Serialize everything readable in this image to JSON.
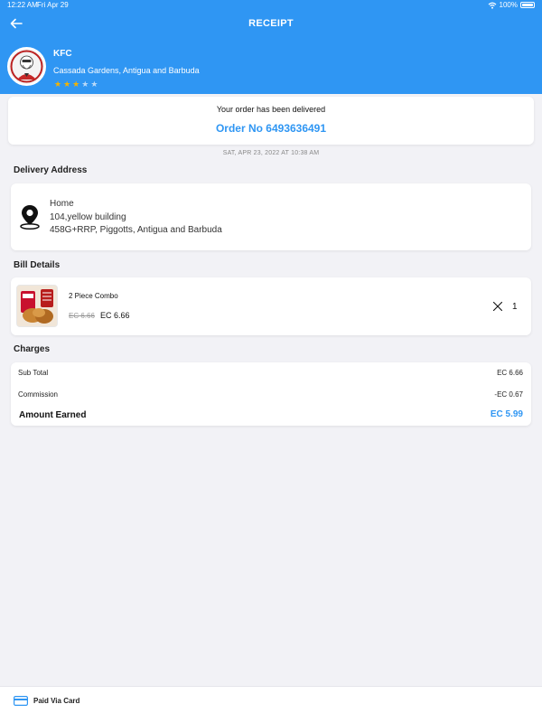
{
  "status_bar": {
    "time": "12:22 AM",
    "date": "Fri Apr 29",
    "battery": "100%"
  },
  "header": {
    "title": "RECEIPT",
    "store_name": "KFC",
    "store_location": "Cassada Gardens, Antigua and Barbuda",
    "rating": 3,
    "rating_max": 5,
    "accent_color": "#2f96f3"
  },
  "order": {
    "message": "Your order has been delivered",
    "order_no": "Order No 6493636491",
    "timestamp": "SAT, APR 23, 2022 AT 10:38 AM"
  },
  "delivery": {
    "section_title": "Delivery Address",
    "icon": "map-pin-icon",
    "label": "Home",
    "line1": "104,yellow building",
    "line2": "458G+RRP, Piggotts, Antigua and Barbuda"
  },
  "bill": {
    "section_title": "Bill Details",
    "item_name": "2 Piece Combo",
    "price_old": "EC 6.66",
    "price_new": "EC 6.66",
    "quantity": "1"
  },
  "charges": {
    "section_title": "Charges",
    "subtotal_label": "Sub Total",
    "subtotal_value": "EC 6.66",
    "commission_label": "Commission",
    "commission_value": "-EC 0.67",
    "earned_label": "Amount Earned",
    "earned_value": "EC 5.99"
  },
  "footer": {
    "payment_text": "Paid Via Card",
    "icon": "credit-card-icon"
  }
}
